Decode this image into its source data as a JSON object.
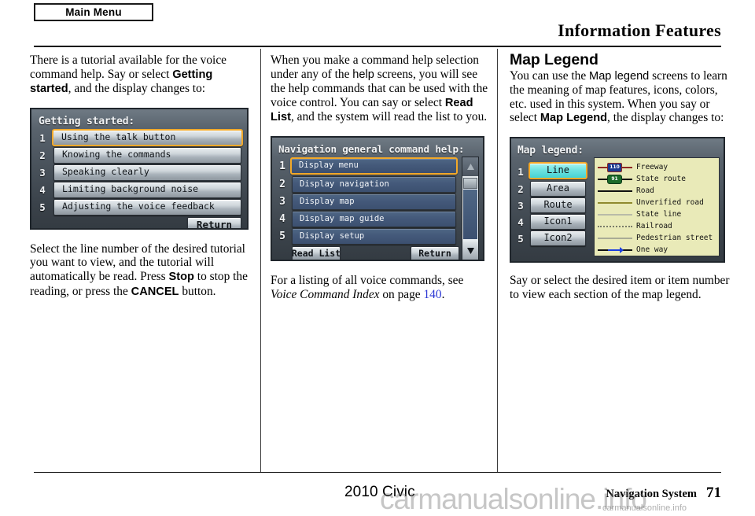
{
  "header": {
    "tab_label": "Main Menu",
    "title": "Information Features"
  },
  "column1": {
    "para1_a": "There is a tutorial available for the voice command help. Say or select ",
    "para1_bold": "Getting started",
    "para1_b": ", and the display changes to:",
    "screen": {
      "title": "Getting started:",
      "rows": [
        {
          "num": "1",
          "label": "Using the talk button",
          "selected": true
        },
        {
          "num": "2",
          "label": "Knowing the commands",
          "selected": false
        },
        {
          "num": "3",
          "label": "Speaking clearly",
          "selected": false
        },
        {
          "num": "4",
          "label": "Limiting background noise",
          "selected": false
        },
        {
          "num": "5",
          "label": "Adjusting the voice feedback",
          "selected": false
        }
      ],
      "return_label": "Return"
    },
    "para2_a": "Select the line number of the desired tutorial you want to view, and the tutorial will automatically be read. Press ",
    "para2_bold1": "Stop",
    "para2_b": " to stop the reading, or press the ",
    "para2_bold2": "CANCEL",
    "para2_c": " button."
  },
  "column2": {
    "para1_a": "When you make a command help selection under any of the ",
    "para1_sans": "help",
    "para1_b": " screens, you will see the help commands that can be used with the voice control. You can say or select ",
    "para1_bold": "Read List",
    "para1_c": ", and the system will read the list to you.",
    "screen": {
      "title": "Navigation general command help:",
      "rows": [
        {
          "num": "1",
          "label": "Display menu",
          "selected": true
        },
        {
          "num": "2",
          "label": "Display navigation",
          "selected": false
        },
        {
          "num": "3",
          "label": "Display map",
          "selected": false
        },
        {
          "num": "4",
          "label": "Display map guide",
          "selected": false
        },
        {
          "num": "5",
          "label": "Display setup",
          "selected": false
        }
      ],
      "read_list_label": "Read List",
      "return_label": "Return",
      "scroll_up_icon": "triangle-up",
      "scroll_down_icon": "triangle-down"
    },
    "para2_a": "For a listing of all voice commands, see ",
    "para2_ital": "Voice Command Index",
    "para2_b": " on page ",
    "para2_page": "140",
    "para2_c": "."
  },
  "column3": {
    "heading": "Map Legend",
    "para1_a": "You can use the ",
    "para1_sans": "Map legend",
    "para1_b": " screens to learn the meaning of map features, icons, colors, etc. used in this system. When you say or select ",
    "para1_bold": "Map Legend",
    "para1_c": ", the display changes to:",
    "screen": {
      "title": "Map legend:",
      "rows": [
        {
          "num": "1",
          "label": "Line",
          "selected": true
        },
        {
          "num": "2",
          "label": "Area",
          "selected": false
        },
        {
          "num": "3",
          "label": "Route",
          "selected": false
        },
        {
          "num": "4",
          "label": "Icon1",
          "selected": false
        },
        {
          "num": "5",
          "label": "Icon2",
          "selected": false
        }
      ],
      "legend": [
        {
          "label": "Freeway",
          "style": "shield-interstate",
          "shield_text": "110",
          "line_color": "#8e2a23"
        },
        {
          "label": "State route",
          "style": "shield-state",
          "shield_text": "91",
          "line_color": "#1a1a1a"
        },
        {
          "label": "Road",
          "style": "solid",
          "line_color": "#111111"
        },
        {
          "label": "Unverified road",
          "style": "solid",
          "line_color": "#8f8a2e"
        },
        {
          "label": "State line",
          "style": "solid",
          "line_color": "#b9bba8"
        },
        {
          "label": "Railroad",
          "style": "dotted",
          "line_color": "#7a7c6a"
        },
        {
          "label": "Pedestrian street",
          "style": "solid",
          "line_color": "#a9ab96"
        },
        {
          "label": "One way",
          "style": "arrow",
          "line_color": "#111111",
          "arrow_color": "#1b3fe0"
        }
      ]
    },
    "para2": "Say or select the desired item or item number to view each section of the map legend."
  },
  "footer": {
    "model": "2010 Civic",
    "section": "Navigation System",
    "page": "71",
    "watermark_large": "carmanualsonline.info",
    "watermark_small": "carmanualsonline.info"
  },
  "colors": {
    "link": "#2b37d4",
    "selection_highlight": "#f2a92a",
    "legend_panel_bg": "#e9eab8",
    "nav_screen_dark": "#3b434b"
  }
}
